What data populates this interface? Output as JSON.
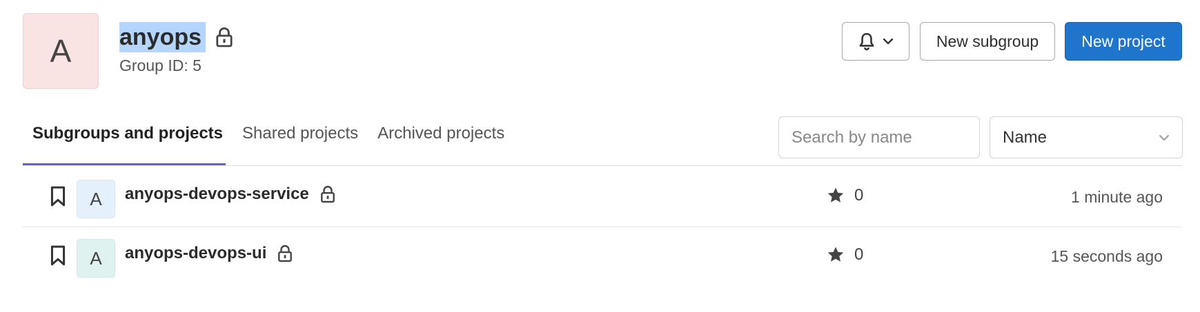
{
  "group": {
    "avatar_letter": "A",
    "name": "anyops",
    "id_text": "Group ID: 5",
    "avatar_color": "#fae3e3"
  },
  "actions": {
    "notification_icon": "bell-icon",
    "new_subgroup": "New subgroup",
    "new_project": "New project",
    "primary_color": "#1f75cb"
  },
  "tabs": [
    {
      "label": "Subgroups and projects",
      "active": true
    },
    {
      "label": "Shared projects",
      "active": false
    },
    {
      "label": "Archived projects",
      "active": false
    }
  ],
  "search": {
    "placeholder": "Search by name",
    "value": ""
  },
  "sort": {
    "selected": "Name"
  },
  "projects": [
    {
      "avatar_letter": "A",
      "avatar_color": "#e4f0fb",
      "name": "anyops-devops-service",
      "private": true,
      "stars": "0",
      "updated": "1 minute ago"
    },
    {
      "avatar_letter": "A",
      "avatar_color": "#e0f2ef",
      "name": "anyops-devops-ui",
      "private": true,
      "stars": "0",
      "updated": "15 seconds ago"
    }
  ]
}
